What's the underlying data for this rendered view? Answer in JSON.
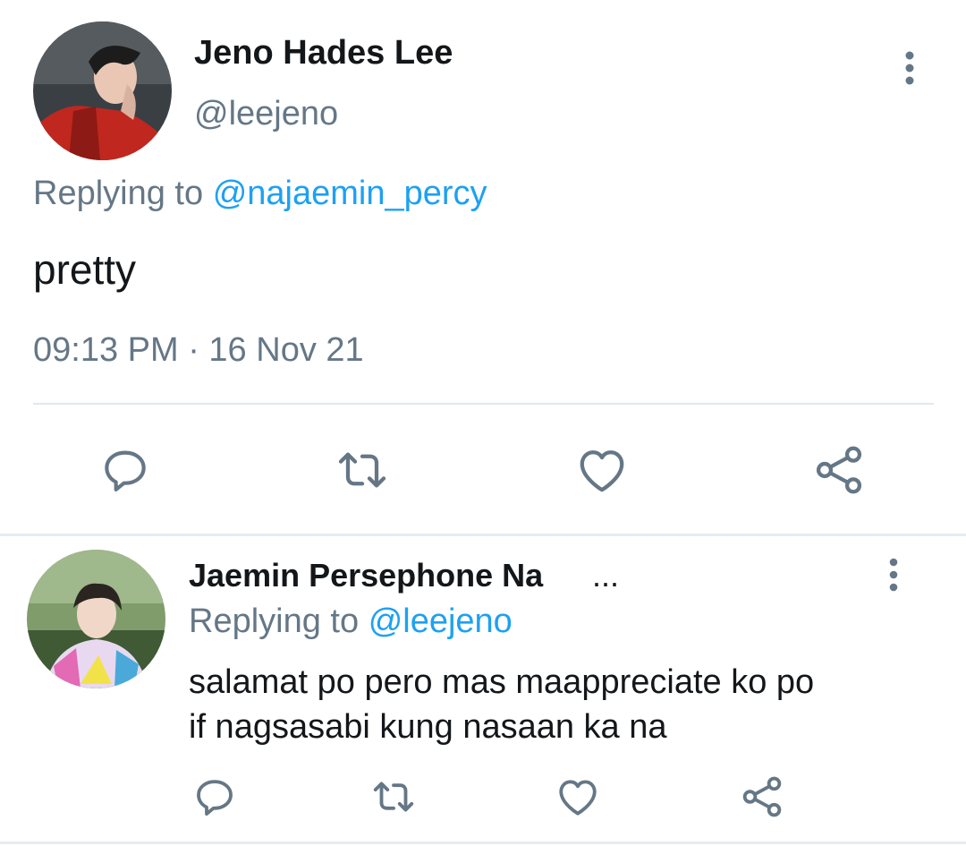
{
  "colors": {
    "text_primary": "#14171a",
    "text_secondary": "#657786",
    "mention": "#1da1f2",
    "divider": "#e1e8ed"
  },
  "main_tweet": {
    "display_name": "Jeno Hades Lee",
    "handle": "@leejeno",
    "replying_prefix": "Replying to",
    "replying_to": "@najaemin_percy",
    "text": "pretty",
    "timestamp": "09:13 PM · 16 Nov 21",
    "icons": {
      "menu": "more-vertical-icon",
      "reply": "reply-icon",
      "retweet": "retweet-icon",
      "like": "heart-icon",
      "share": "share-icon"
    }
  },
  "reply_tweet": {
    "display_name": "Jaemin Persephone Na",
    "name_ellipsis": "...",
    "replying_prefix": "Replying to",
    "replying_to": "@leejeno",
    "text_lines": [
      "salamat po pero mas maappreciate ko po",
      "if nagsasabi kung nasaan ka na"
    ],
    "icons": {
      "menu": "more-vertical-icon",
      "reply": "reply-icon",
      "retweet": "retweet-icon",
      "like": "heart-icon",
      "share": "share-icon"
    }
  }
}
